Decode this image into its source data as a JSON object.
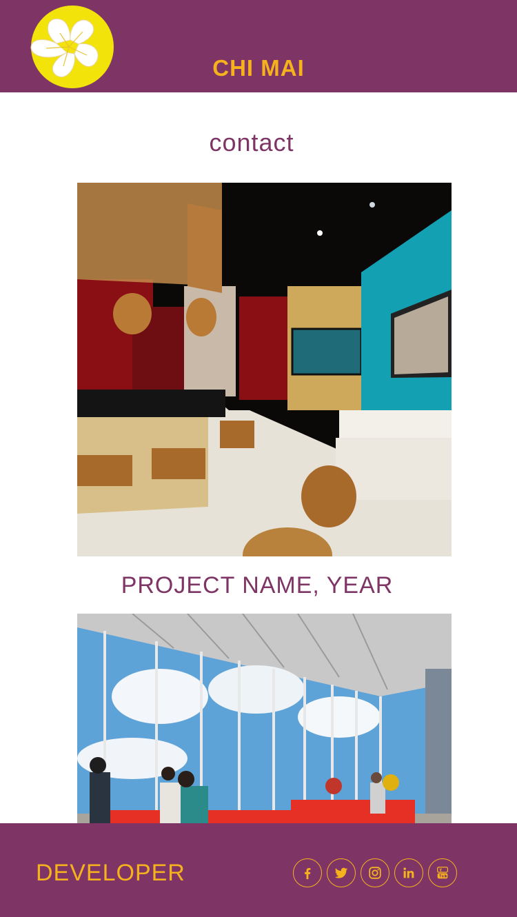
{
  "header": {
    "title": "CHI MAI",
    "logo_icon": "flower-logo-icon"
  },
  "nav": {
    "contact_label": "contact"
  },
  "gallery": {
    "images": [
      {
        "subject": "interior-cafe-render",
        "caption": "PROJECT NAME, YEAR"
      },
      {
        "subject": "glass-lounge-render"
      }
    ]
  },
  "footer": {
    "label": "DEVELOPER",
    "socials": [
      {
        "icon": "facebook-icon"
      },
      {
        "icon": "twitter-icon"
      },
      {
        "icon": "instagram-icon"
      },
      {
        "icon": "linkedin-icon"
      },
      {
        "icon": "youtube-icon"
      }
    ]
  },
  "colors": {
    "brand_purple": "#7e3566",
    "accent_gold": "#f5b21d",
    "logo_yellow": "#f2e30a"
  }
}
